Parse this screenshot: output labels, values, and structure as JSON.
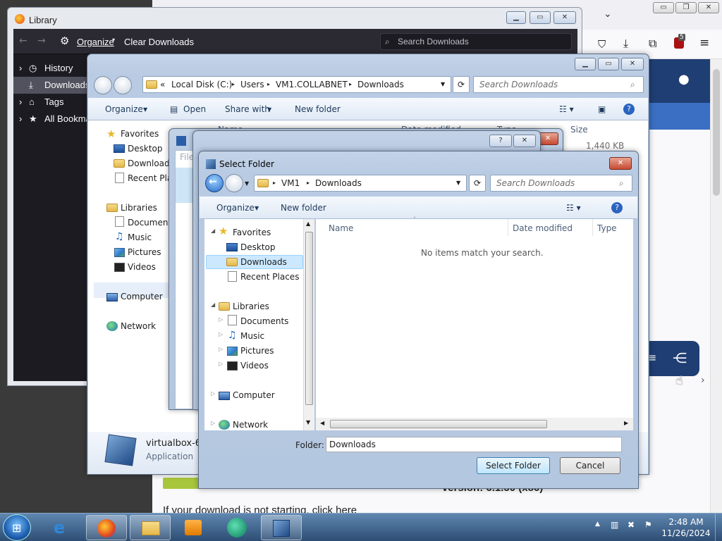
{
  "browser_bg": {
    "bottom_text": "If your download is not starting, click here",
    "version_text": "Version: 6.1.50 (x86)"
  },
  "library": {
    "title": "Library",
    "toolbar": {
      "organize": "Organize",
      "clear": "Clear Downloads",
      "search_placeholder": "Search Downloads"
    },
    "sidebar": [
      "History",
      "Downloads",
      "Tags",
      "All Bookmarks"
    ]
  },
  "explorer": {
    "address": [
      "Local Disk (C:)",
      "Users",
      "VM1.COLLABNET",
      "Downloads"
    ],
    "search_placeholder": "Search Downloads",
    "cmd": {
      "organize": "Organize",
      "open": "Open",
      "share": "Share with",
      "new_folder": "New folder"
    },
    "nav": {
      "favorites": "Favorites",
      "desktop": "Desktop",
      "downloads": "Downloads",
      "recent": "Recent Places",
      "libraries": "Libraries",
      "documents": "Documents",
      "music": "Music",
      "pictures": "Pictures",
      "videos": "Videos",
      "computer": "Computer",
      "network": "Network"
    },
    "col_name": "Name",
    "col_date": "Date modified",
    "col_type": "Type",
    "col_size": "Size",
    "size_value": "1,440 KB",
    "details": {
      "name": "virtualbox-6.1",
      "type": "Application"
    }
  },
  "mid_dialog": {
    "file_label": "File"
  },
  "select_folder": {
    "title": "Select Folder",
    "address": [
      "VM1",
      "Downloads"
    ],
    "search_placeholder": "Search Downloads",
    "cmd": {
      "organize": "Organize",
      "new_folder": "New folder"
    },
    "nav": {
      "favorites": "Favorites",
      "desktop": "Desktop",
      "downloads": "Downloads",
      "recent": "Recent Places",
      "libraries": "Libraries",
      "documents": "Documents",
      "music": "Music",
      "pictures": "Pictures",
      "videos": "Videos",
      "computer": "Computer",
      "network": "Network"
    },
    "columns": {
      "name": "Name",
      "date": "Date modified",
      "type": "Type"
    },
    "empty_message": "No items match your search.",
    "folder_label": "Folder:",
    "folder_value": "Downloads",
    "select_button": "Select Folder",
    "cancel_button": "Cancel"
  },
  "taskbar": {
    "time": "2:48 AM",
    "date": "11/26/2024"
  },
  "badges": {
    "ublock_count": "5"
  },
  "colors": {
    "accent_navy": "#1f3e73",
    "selection": "#cce8ff",
    "taskbar": "#2d4d74"
  }
}
